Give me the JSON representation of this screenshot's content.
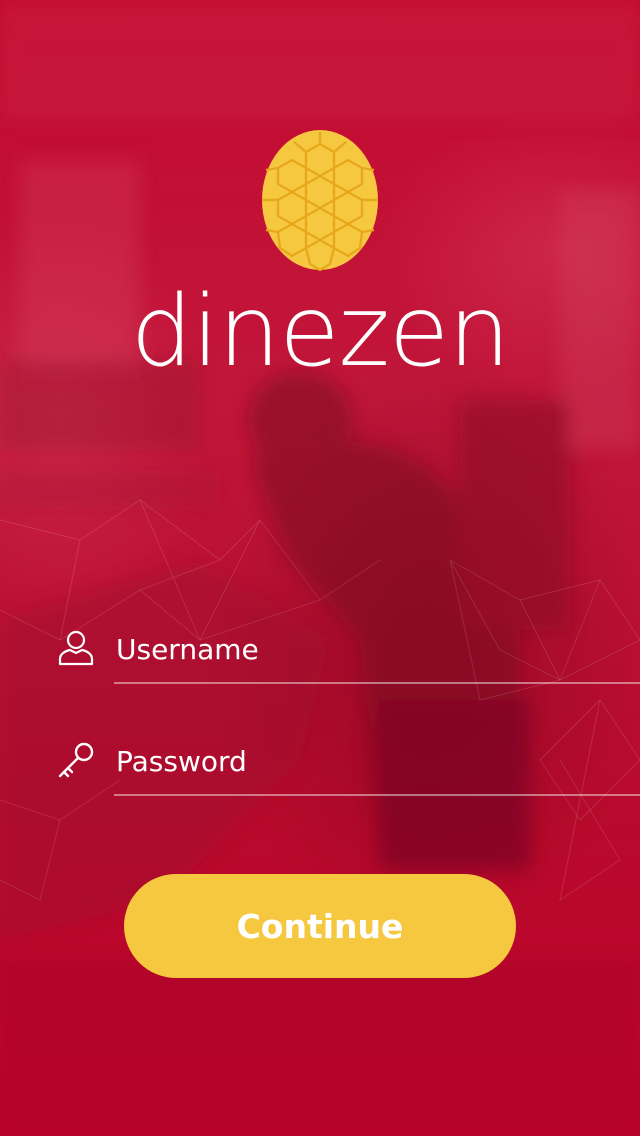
{
  "brand": {
    "name": "dinezen",
    "logo_icon": "turtle-shell-icon",
    "logo_color": "#f5c840",
    "logo_line_color": "#e8a81c"
  },
  "login_form": {
    "username": {
      "placeholder": "Username",
      "value": "",
      "icon": "user-icon"
    },
    "password": {
      "placeholder": "Password",
      "value": "",
      "icon": "key-icon"
    },
    "continue_label": "Continue"
  },
  "colors": {
    "background": "#c0072d",
    "accent": "#f5c840",
    "text": "#ffffff"
  }
}
